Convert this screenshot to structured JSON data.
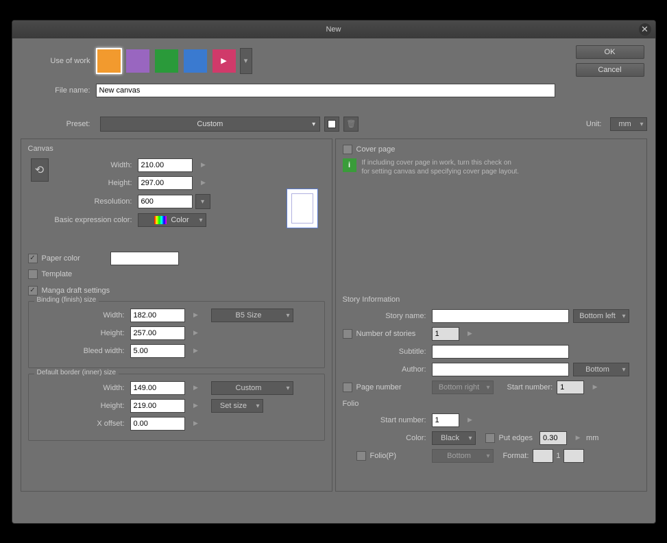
{
  "title": "New",
  "buttons": {
    "ok": "OK",
    "cancel": "Cancel"
  },
  "labels": {
    "use_of_work": "Use of work",
    "file_name": "File name:",
    "preset": "Preset:",
    "unit": "Unit:"
  },
  "file_name": "New canvas",
  "preset": "Custom",
  "unit": "mm",
  "canvas": {
    "title": "Canvas",
    "width_label": "Width:",
    "width": "210.00",
    "height_label": "Height:",
    "height": "297.00",
    "resolution_label": "Resolution:",
    "resolution": "600",
    "expr_label": "Basic expression color:",
    "expr_value": "Color",
    "paper_color_label": "Paper color",
    "template_label": "Template"
  },
  "manga": {
    "label": "Manga draft settings",
    "binding": {
      "title": "Binding (finish) size",
      "width_label": "Width:",
      "width": "182.00",
      "height_label": "Height:",
      "height": "257.00",
      "bleed_label": "Bleed width:",
      "bleed": "5.00",
      "size_preset": "B5 Size"
    },
    "inner": {
      "title": "Default border (inner) size",
      "width_label": "Width:",
      "width": "149.00",
      "height_label": "Height:",
      "height": "219.00",
      "xoffset_label": "X offset:",
      "xoffset": "0.00",
      "preset": "Custom",
      "set_size": "Set size"
    }
  },
  "cover": {
    "label": "Cover page",
    "hint": "If including cover page in work, turn this check on\nfor setting canvas and specifying cover page layout."
  },
  "story": {
    "title": "Story Information",
    "name_label": "Story name:",
    "name_pos": "Bottom left",
    "num_label": "Number of stories",
    "num": "1",
    "subtitle_label": "Subtitle:",
    "author_label": "Author:",
    "author_pos": "Bottom",
    "pagenum_label": "Page number",
    "pagenum_pos": "Bottom right",
    "start_label": "Start number:",
    "start": "1"
  },
  "folio": {
    "title": "Folio",
    "start_label": "Start number:",
    "start": "1",
    "color_label": "Color:",
    "color": "Black",
    "edges_label": "Put edges",
    "edges": "0.30",
    "mm": "mm",
    "folio_p_label": "Folio(P)",
    "pos": "Bottom",
    "format_label": "Format:",
    "format_val": "1"
  },
  "use_icons": {
    "c1": "#f29a2e",
    "c2": "#9966c0",
    "c3": "#2a9a3a",
    "c4": "#3a7ad0",
    "c5": "#d03a6a"
  }
}
